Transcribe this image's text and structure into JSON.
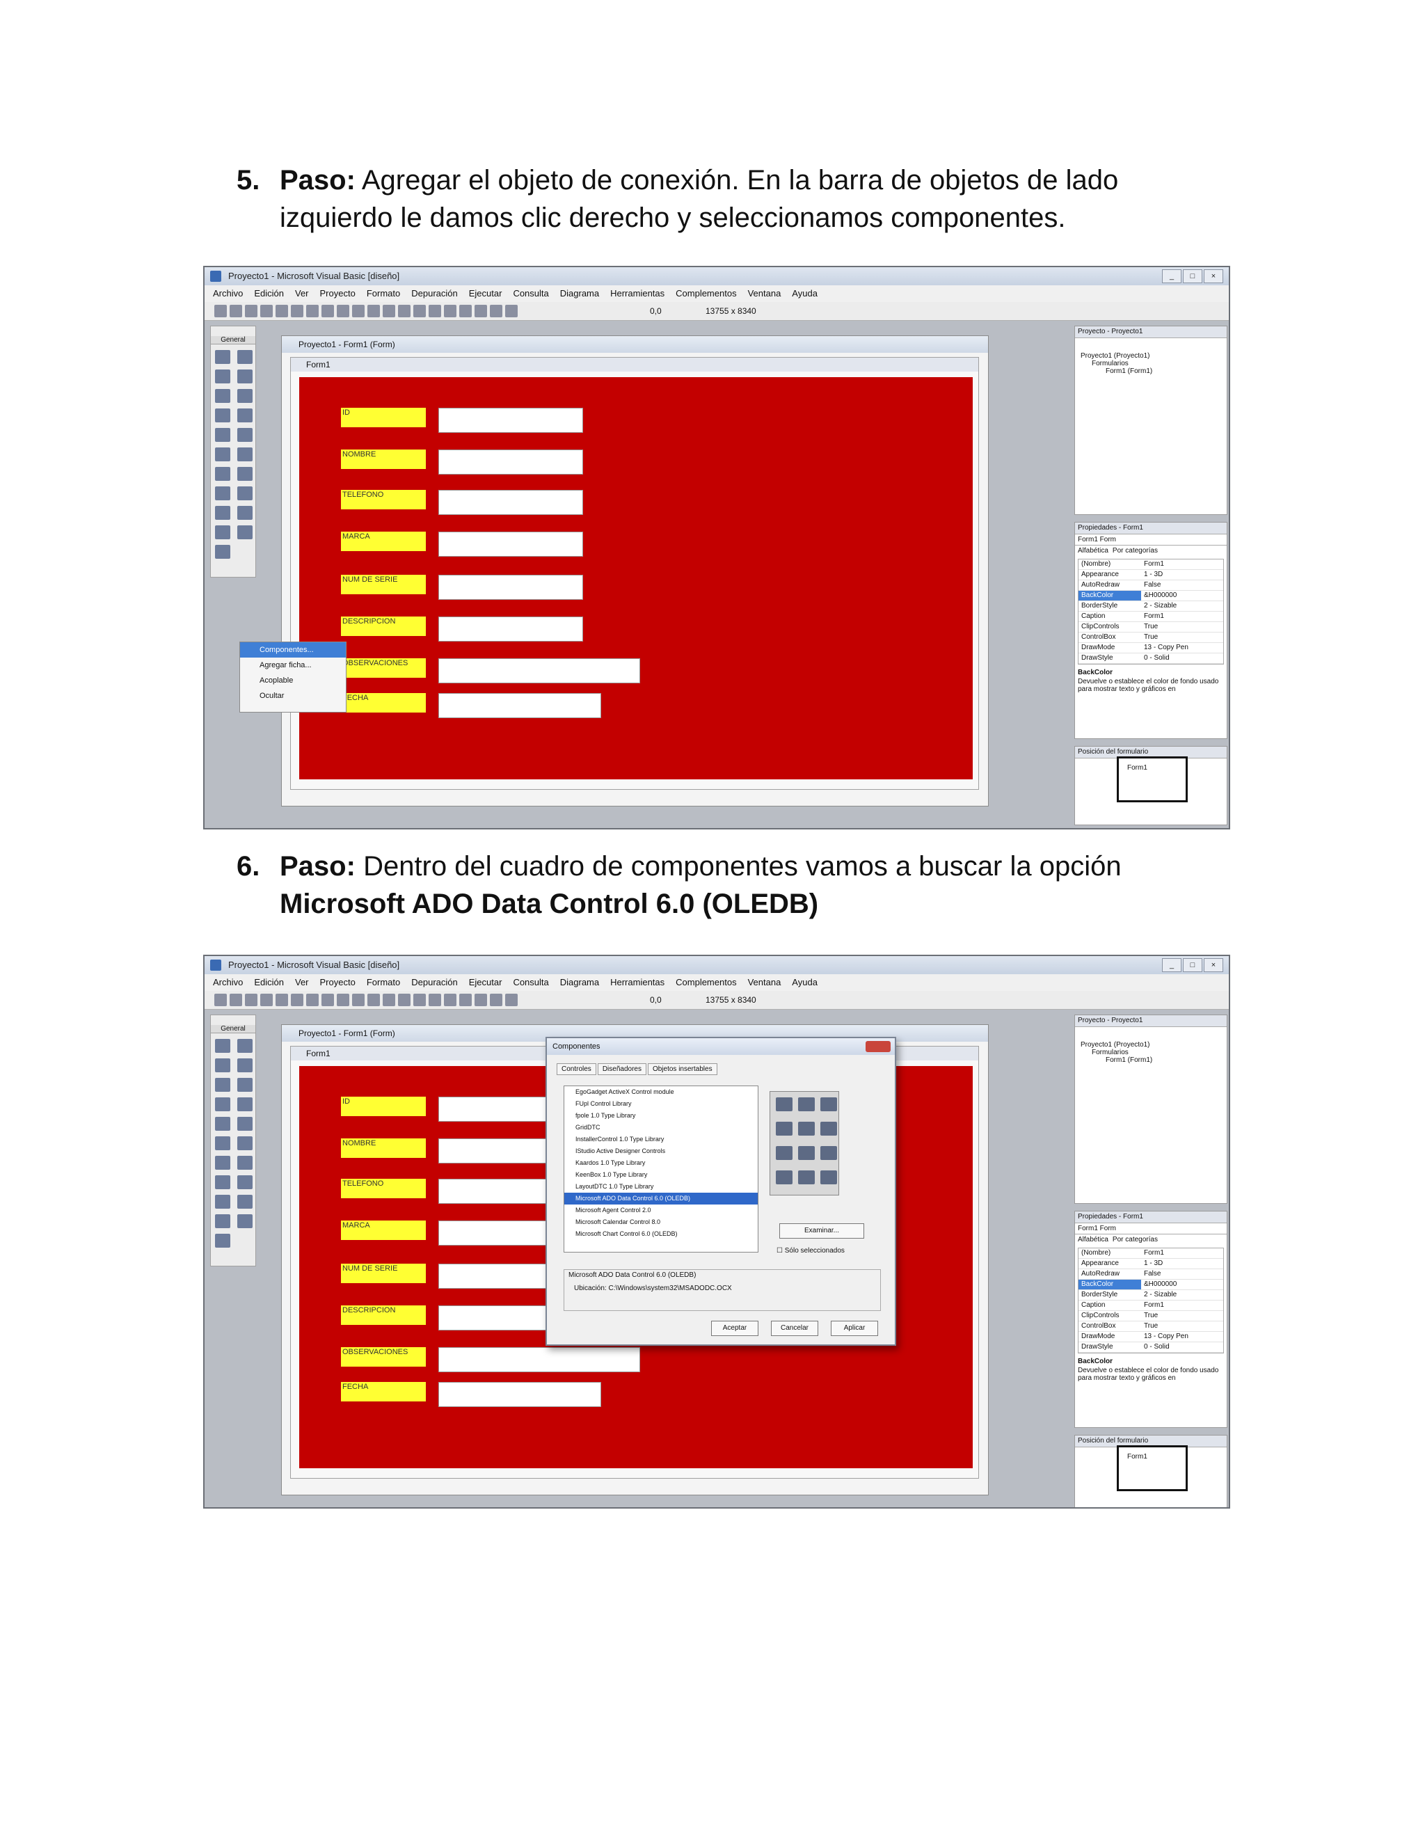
{
  "steps": [
    {
      "number": "5.",
      "bold": "Paso:",
      "text_line1": "Agregar el objeto de conexión. En la barra de objetos de lado",
      "text_line2": "izquierdo le damos clic derecho y seleccionamos componentes."
    },
    {
      "number": "6.",
      "bold": "Paso:",
      "text_line1": "Dentro del cuadro de componentes vamos a buscar la opción",
      "text_bold_line2": "Microsoft ADO Data Control 6.0 (OLEDB)"
    }
  ],
  "vb": {
    "window_title": "Proyecto1 - Microsoft Visual Basic [diseño]",
    "menu": [
      "Archivo",
      "Edición",
      "Ver",
      "Proyecto",
      "Formato",
      "Depuración",
      "Ejecutar",
      "Consulta",
      "Diagrama",
      "Herramientas",
      "Complementos",
      "Ventana",
      "Ayuda"
    ],
    "toolbar_coord": "0,0",
    "toolbar_size": "13755 x 8340",
    "toolbox_header": "General",
    "mdi_title": "Proyecto1 - Form1 (Form)",
    "form_title": "Form1",
    "labels": [
      "ID",
      "NOMBRE",
      "TELEFONO",
      "MARCA",
      "NUM DE SERIE",
      "DESCRIPCION",
      "OBSERVACIONES",
      "FECHA"
    ],
    "project_panel_title": "Proyecto - Proyecto1",
    "project_tree": [
      "Proyecto1 (Proyecto1)",
      "Formularios",
      "Form1 (Form1)"
    ],
    "props_panel_title": "Propiedades - Form1",
    "props_object": "Form1 Form",
    "props_tabs": [
      "Alfabética",
      "Por categorías"
    ],
    "props": [
      [
        "(Nombre)",
        "Form1"
      ],
      [
        "Appearance",
        "1 - 3D"
      ],
      [
        "AutoRedraw",
        "False"
      ],
      [
        "BackColor",
        "&H000000"
      ],
      [
        "BorderStyle",
        "2 - Sizable"
      ],
      [
        "Caption",
        "Form1"
      ],
      [
        "ClipControls",
        "True"
      ],
      [
        "ControlBox",
        "True"
      ],
      [
        "DrawMode",
        "13 - Copy Pen"
      ],
      [
        "DrawStyle",
        "0 - Solid"
      ]
    ],
    "props_desc_title": "BackColor",
    "props_desc": "Devuelve o establece el color de fondo usado para mostrar texto y gráficos en",
    "formpos_title": "Posición del formulario",
    "formpos_label": "Form1",
    "context_menu": [
      "Componentes...",
      "Agregar ficha...",
      "Acoplable",
      "Ocultar"
    ]
  },
  "dialog": {
    "title": "Componentes",
    "tabs": [
      "Controles",
      "Diseñadores",
      "Objetos insertables"
    ],
    "items": [
      "EgoGadget ActiveX Control module",
      "FUpl Control Library",
      "fpole 1.0 Type Library",
      "GridDTC",
      "InstallerControl 1.0 Type Library",
      "IStudio Active Designer Controls",
      "Kaardos 1.0 Type Library",
      "KeenBox 1.0 Type Library",
      "LayoutDTC 1.0 Type Library",
      "Microsoft ADO Data Control 6.0 (OLEDB)",
      "Microsoft Agent Control 2.0",
      "Microsoft Calendar Control 8.0",
      "Microsoft Chart Control 6.0 (OLEDB)"
    ],
    "browse": "Examinar...",
    "selected_only": "Sólo seleccionados",
    "group_title": "Microsoft ADO Data Control 6.0 (OLEDB)",
    "location": "Ubicación:  C:\\Windows\\system32\\MSADODC.OCX",
    "ok": "Aceptar",
    "cancel": "Cancelar",
    "apply": "Aplicar"
  }
}
